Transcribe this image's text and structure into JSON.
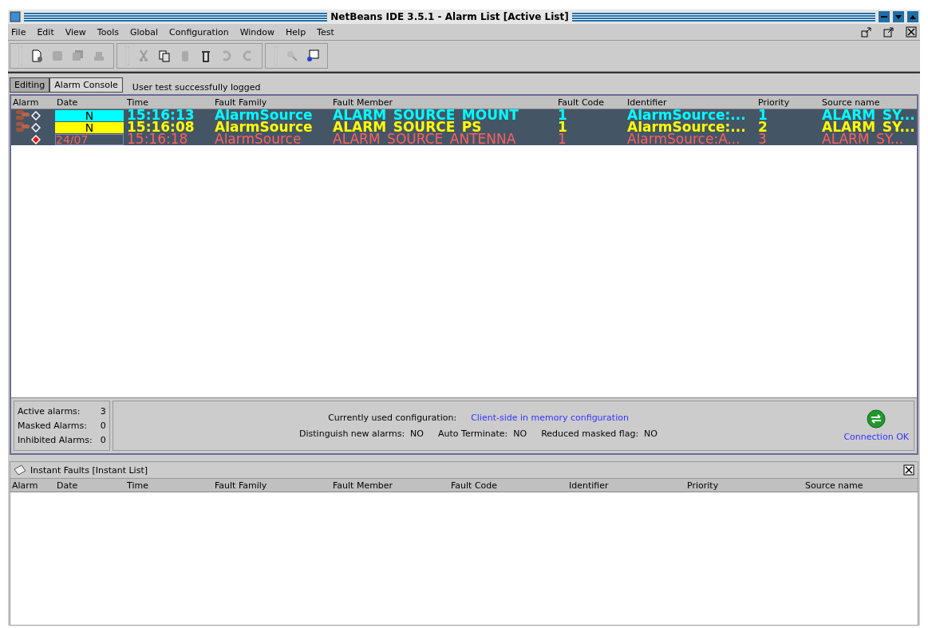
{
  "window": {
    "title": "NetBeans IDE 3.5.1 - Alarm List [Active List]"
  },
  "menu": [
    "File",
    "Edit",
    "View",
    "Tools",
    "Global",
    "Configuration",
    "Window",
    "Help",
    "Test"
  ],
  "tabs": [
    {
      "label": "Editing",
      "selected": false
    },
    {
      "label": "Alarm Console",
      "selected": true
    }
  ],
  "status_message": "User test  successfully logged",
  "active_list": {
    "columns": [
      "Alarm",
      "Date",
      "Time",
      "Fault Family",
      "Fault Member",
      "Fault Code",
      "Identifier",
      "Priority",
      "Source name"
    ],
    "rows": [
      {
        "new": true,
        "color": "#00ffff",
        "date": "N",
        "time": "15:16:13",
        "fault_family": "AlarmSource",
        "fault_member": "ALARM_SOURCE_MOUNT",
        "fault_code": "1",
        "identifier": "AlarmSource:...",
        "priority": "1",
        "source_name": "ALARM_SY..."
      },
      {
        "new": true,
        "color": "#ffff00",
        "date": "N",
        "time": "15:16:08",
        "fault_family": "AlarmSource",
        "fault_member": "ALARM_SOURCE_PS",
        "fault_code": "1",
        "identifier": "AlarmSource:...",
        "priority": "2",
        "source_name": "ALARM_SY..."
      },
      {
        "new": false,
        "color": "#ff6060",
        "date": "24/07",
        "time": "15:16:18",
        "fault_family": "AlarmSource",
        "fault_member": "ALARM_SOURCE_ANTENNA",
        "fault_code": "1",
        "identifier": "AlarmSource:A...",
        "priority": "3",
        "source_name": "ALARM_SY..."
      }
    ]
  },
  "stats": [
    {
      "label": "Active alarms:",
      "value": "3"
    },
    {
      "label": "Masked Alarms:",
      "value": "0"
    },
    {
      "label": "Inhibited Alarms:",
      "value": "0"
    }
  ],
  "configuration": {
    "label": "Currently used configuration:",
    "value": "Client-side in memory configuration"
  },
  "flags": [
    {
      "label": "Distinguish new alarms:",
      "value": "NO"
    },
    {
      "label": "Auto Terminate:",
      "value": "NO"
    },
    {
      "label": "Reduced masked flag:",
      "value": "NO"
    }
  ],
  "connection": "Connection OK",
  "instant_list": {
    "title": "Instant Faults [Instant List]",
    "columns": [
      "Alarm",
      "Date",
      "Time",
      "Fault Family",
      "Fault Member",
      "Fault Code",
      "Identifier",
      "Priority",
      "Source name"
    ]
  }
}
